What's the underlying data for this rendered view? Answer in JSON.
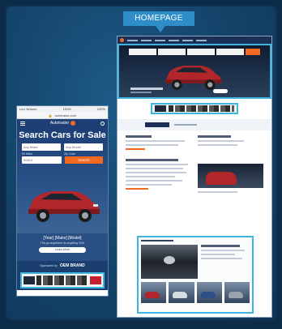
{
  "header": {
    "tag_label": "HOMEPAGE"
  },
  "mobile": {
    "status_left": "••••• Verizon",
    "status_time": "10:09",
    "status_right": "100%",
    "url": "autotrader.com",
    "logo_text": "Autotrader",
    "hero_title": "Search Cars for Sale",
    "make_placeholder": "Any Make",
    "model_placeholder": "Any Model",
    "radius_label": "50 Miles",
    "zip_label": "Zip Code",
    "zip_value": "90810",
    "search_label": "Search",
    "promo_line1": "[Year] [Make] [Model]",
    "promo_line2": "The go-anywhere do-anything SUV",
    "learn_more": "Learn More",
    "sponsored_by": "Sponsored by",
    "brand": "OEM BRAND"
  },
  "colors": {
    "accent": "#3fb6df",
    "brand_orange": "#f26a21",
    "nav_blue": "#1b2f56",
    "car_red": "#b1262b"
  }
}
